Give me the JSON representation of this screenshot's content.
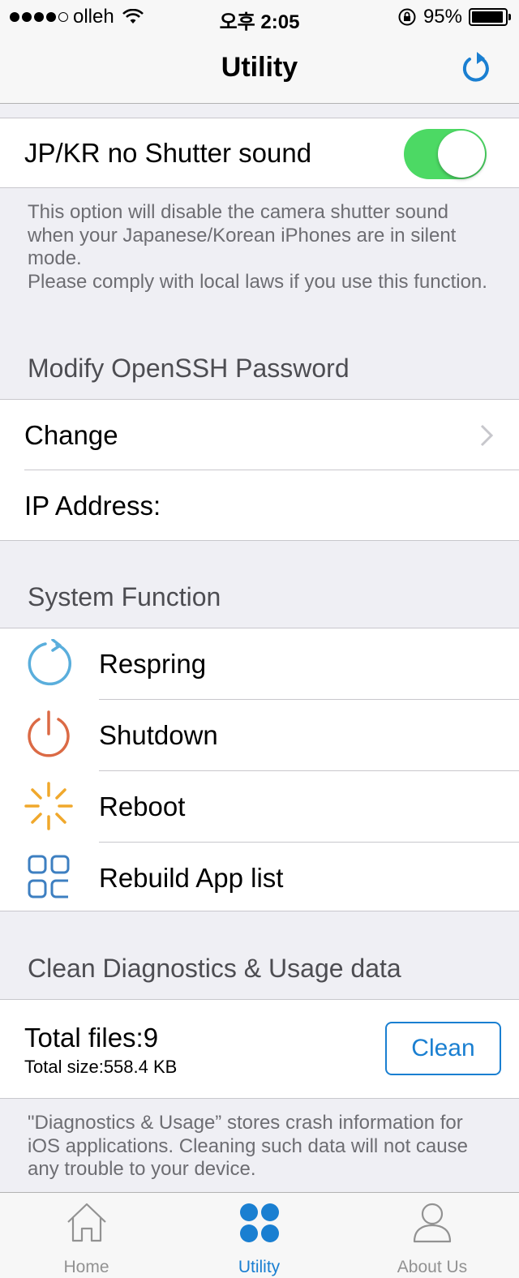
{
  "status_bar": {
    "carrier": "olleh",
    "time": "오후 2:05",
    "battery_percent": "95%",
    "battery_level": 0.95,
    "signal_bars": 4
  },
  "nav": {
    "title": "Utility",
    "refresh_icon": "refresh-icon"
  },
  "shutter": {
    "label": "JP/KR no Shutter sound",
    "enabled": true,
    "description_1": "This option will disable the camera shutter sound when your Japanese/Korean iPhones are in silent mode.",
    "description_2": "Please comply with local laws if you use this function."
  },
  "openssh": {
    "header": "Modify OpenSSH Password",
    "change_label": "Change",
    "ip_label": "IP Address:"
  },
  "system": {
    "header": "System Function",
    "items": [
      {
        "label": "Respring",
        "icon": "respring-icon",
        "color": "#5aaedc"
      },
      {
        "label": "Shutdown",
        "icon": "power-icon",
        "color": "#db6a45"
      },
      {
        "label": "Reboot",
        "icon": "reboot-icon",
        "color": "#f0a82c"
      },
      {
        "label": "Rebuild App list",
        "icon": "app-grid-icon",
        "color": "#3d7fc1"
      }
    ]
  },
  "diagnostics": {
    "header": "Clean Diagnostics & Usage data",
    "total_files": "Total files:9",
    "total_size": "Total size:558.4 KB",
    "clean_label": "Clean",
    "footer": "\"Diagnostics & Usage” stores crash information for iOS applications. Cleaning such data will not cause any trouble to your device."
  },
  "tabbar": {
    "tabs": [
      {
        "label": "Home",
        "icon": "home-icon",
        "active": false
      },
      {
        "label": "Utility",
        "icon": "utility-dots-icon",
        "active": true
      },
      {
        "label": "About Us",
        "icon": "person-icon",
        "active": false
      }
    ]
  },
  "colors": {
    "accent": "#1a7fd1",
    "toggle_on": "#4cd964",
    "background": "#efeff4"
  }
}
